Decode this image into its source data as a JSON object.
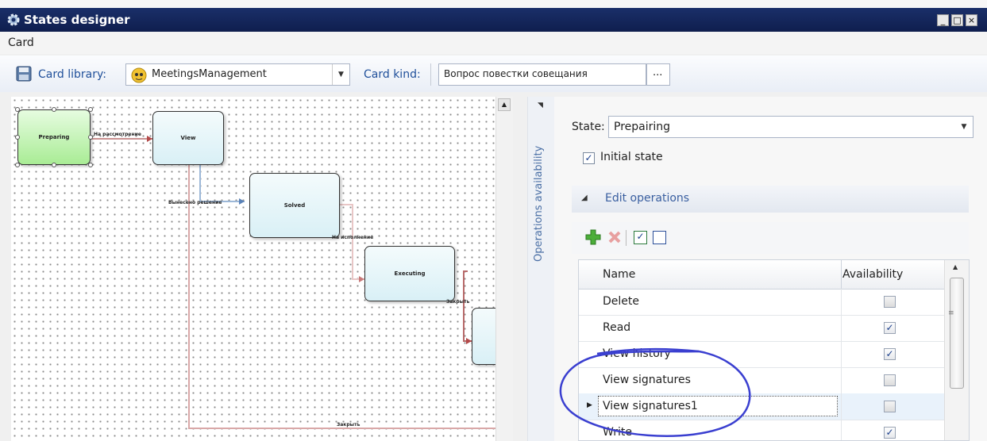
{
  "window": {
    "title": "States designer",
    "controls": [
      "_",
      "□",
      "×"
    ],
    "icon": "gear-icon"
  },
  "menu": {
    "card": "Card"
  },
  "toolbar": {
    "save_icon": "floppy-disk-icon",
    "card_library_label": "Card library:",
    "card_library_value": "MeetingsManagement",
    "card_kind_label": "Card kind:",
    "card_kind_value": "Вопрос повестки совещания",
    "browse_label": "..."
  },
  "diagram": {
    "nodes": [
      {
        "label": "Preparing",
        "selected": true
      },
      {
        "label": "View"
      },
      {
        "label": "Solved"
      },
      {
        "label": "Executing"
      },
      {
        "label": ""
      }
    ],
    "edge_labels": [
      "На рассмотрение",
      "Вынесено решение",
      "На исполнение",
      "Закрыть",
      "Закрыть"
    ]
  },
  "side_tab": {
    "label": "Operations availability"
  },
  "panel": {
    "state_label": "State:",
    "state_value": "Prepairing",
    "initial_state_label": "Initial state",
    "initial_state_checked": true,
    "section_title": "Edit operations",
    "toolbar_icons": [
      "add-icon",
      "delete-icon",
      "check-all-icon",
      "uncheck-all-icon"
    ]
  },
  "grid": {
    "col_name": "Name",
    "col_availability": "Availability",
    "rows": [
      {
        "name": "Delete",
        "available": false
      },
      {
        "name": "Read",
        "available": true
      },
      {
        "name": "View history",
        "available": true
      },
      {
        "name": "View signatures",
        "available": false
      },
      {
        "name": "View signatures1",
        "available": false,
        "editing": true
      },
      {
        "name": "Write",
        "available": true
      }
    ]
  },
  "colors": {
    "titlebar": "#0f1e4e",
    "link_blue": "#1f4f9a",
    "annotation_circle": "#3a3fd0",
    "selected_node": "#a9ec95",
    "node": "#d9f0f6"
  }
}
